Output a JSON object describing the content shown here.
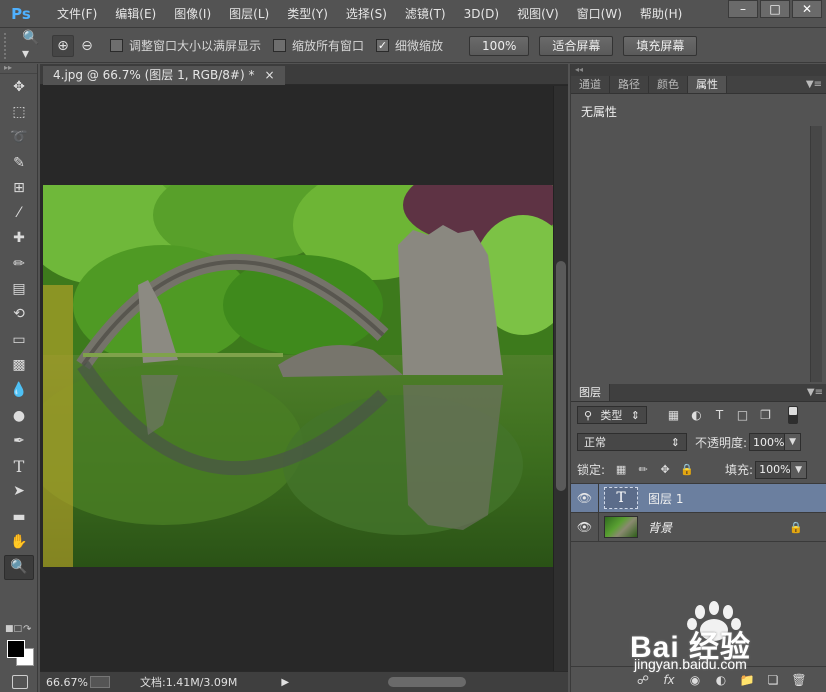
{
  "app": {
    "logo": "Ps",
    "menu": [
      "文件(F)",
      "编辑(E)",
      "图像(I)",
      "图层(L)",
      "类型(Y)",
      "选择(S)",
      "滤镜(T)",
      "3D(D)",
      "视图(V)",
      "窗口(W)",
      "帮助(H)"
    ],
    "window_controls": [
      "minimize-icon",
      "maximize-icon",
      "close-icon"
    ]
  },
  "options": {
    "resize_windows_label": "调整窗口大小以满屏显示",
    "resize_windows_checked": false,
    "zoom_all_label": "缩放所有窗口",
    "zoom_all_checked": false,
    "scrubby_label": "细微缩放",
    "scrubby_checked": true,
    "btn_100": "100%",
    "btn_fit": "适合屏幕",
    "btn_fill": "填充屏幕"
  },
  "document": {
    "tab_title": "4.jpg @ 66.7% (图层 1, RGB/8#) *",
    "tab_close": "×",
    "zoom": "66.67%",
    "doc_info": "文档:1.41M/3.09M",
    "status_arrow": "▶"
  },
  "panels": {
    "top_tabs": [
      "通道",
      "路径",
      "颜色",
      "属性"
    ],
    "active_top_tab": "属性",
    "properties_text": "无属性",
    "layers_tab": "图层",
    "filter_kind": "类型",
    "blend_mode": "正常",
    "opacity_label": "不透明度:",
    "opacity_value": "100%",
    "lock_label": "锁定:",
    "fill_label": "填充:",
    "fill_value": "100%",
    "layers": [
      {
        "name": "图层 1",
        "type": "text",
        "selected": true,
        "visible": true
      },
      {
        "name": "背景",
        "type": "image",
        "selected": false,
        "visible": true,
        "locked": true
      }
    ]
  },
  "watermark": {
    "brand": "Bai 经验",
    "url": "jingyan.baidu.com"
  },
  "colors": {
    "panel_bg": "#535353",
    "canvas_bg": "#282828",
    "selected_layer": "#6b7f9f",
    "ps_blue": "#4fb1ff"
  }
}
